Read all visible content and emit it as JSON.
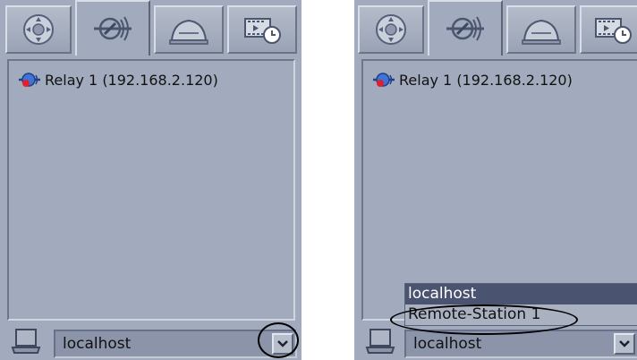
{
  "tabs": [
    {
      "name": "controls",
      "icon": "dial-pad-icon",
      "active": false
    },
    {
      "name": "relays",
      "icon": "relay-icon",
      "active": true
    },
    {
      "name": "alarm",
      "icon": "alarm-bell-icon",
      "active": false
    },
    {
      "name": "recordings",
      "icon": "film-clock-icon",
      "active": false
    }
  ],
  "left_panel": {
    "tree": [
      {
        "label": "Relay 1 (192.168.2.120)",
        "icon": "relay-status-icon"
      }
    ],
    "station_select": {
      "value": "localhost"
    }
  },
  "right_panel": {
    "tree": [
      {
        "label": "Relay 1 (192.168.2.120)",
        "icon": "relay-status-icon"
      }
    ],
    "station_select": {
      "value": "localhost",
      "options": [
        "localhost",
        "Remote-Station 1"
      ],
      "highlighted_option": "localhost"
    }
  },
  "colors": {
    "panel_bg": "#a2abbd",
    "dropdown_highlight": "#4a5470",
    "relay_icon_blue": "#2a5bc4",
    "relay_icon_red": "#e0202a"
  }
}
